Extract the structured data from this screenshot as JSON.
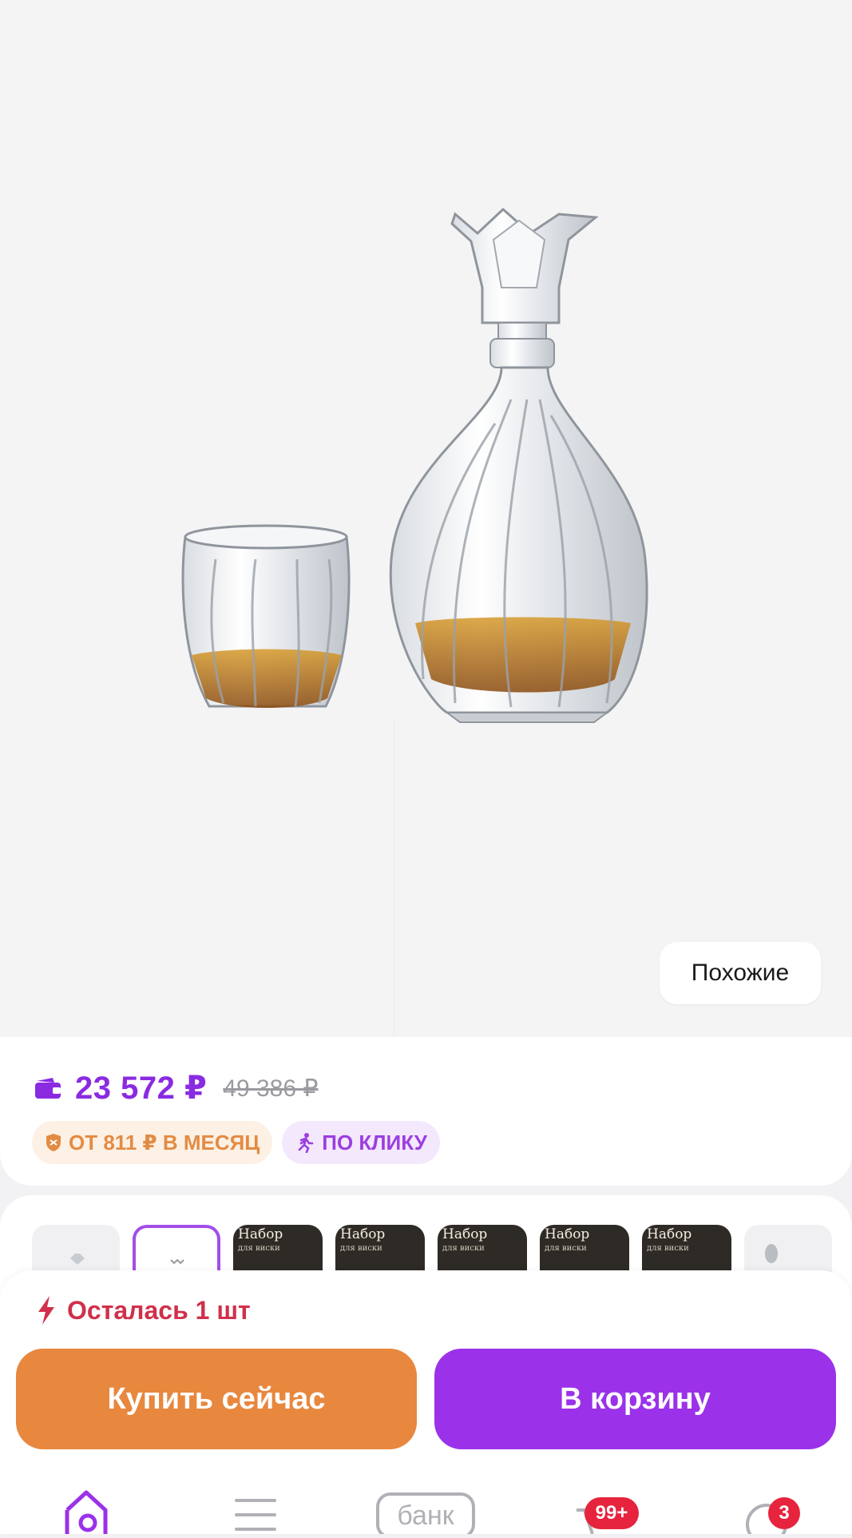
{
  "gallery": {
    "similar_label": "Похожие"
  },
  "price": {
    "current": "23 572 ₽",
    "old": "49 386 ₽"
  },
  "badges": {
    "installment": "ОТ 811 ₽ В МЕСЯЦ",
    "one_click": "ПО КЛИКУ"
  },
  "variants": {
    "items": [
      {
        "title": ""
      },
      {
        "title": ""
      },
      {
        "title": "Набор",
        "sub": "для виски"
      },
      {
        "title": "Набор",
        "sub": "для виски"
      },
      {
        "title": "Набор",
        "sub": "для виски"
      },
      {
        "title": "Набор",
        "sub": "для виски"
      },
      {
        "title": "Набор",
        "sub": "для виски"
      },
      {
        "title": ""
      }
    ]
  },
  "stock": {
    "text": "Осталась 1 шт"
  },
  "actions": {
    "buy_now": "Купить сейчас",
    "add_to_cart": "В корзину"
  },
  "tabbar": {
    "bank_label": "банк",
    "cart_count": "99+",
    "profile_count": "3"
  },
  "colors": {
    "accent": "#9b32ea",
    "buy_now": "#e8873e",
    "stock_alert": "#d0304a",
    "badge_red": "#e6243d"
  }
}
